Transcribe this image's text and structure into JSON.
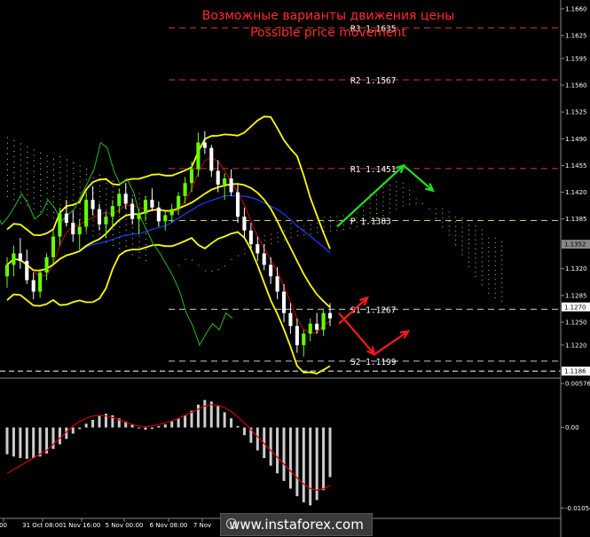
{
  "chart_data": {
    "type": "candlestick",
    "title": "Возможные варианты движения цены",
    "subtitle": "Possible price movement",
    "y_ticks": [
      "1.1660",
      "1.1625",
      "1.1595",
      "1.1560",
      "1.1525",
      "1.1490",
      "1.1455",
      "1.1420",
      "1.1385",
      "1.1320",
      "1.1285",
      "1.1250",
      "1.1220"
    ],
    "x_ticks": [
      "00",
      "31 Oct 08:00",
      "1 Nov 16:00",
      "5 Nov 00:00",
      "6 Nov 08:00",
      "7 Nov"
    ],
    "ylim": [
      1.1178,
      1.1668
    ],
    "current_price": "1.1352",
    "price_marker_1": "1.1270",
    "price_marker_2": "1.1186",
    "levels": [
      {
        "name": "R3",
        "value": 1.1635,
        "label": "R3 1.1635",
        "color": "#d23a3a"
      },
      {
        "name": "R2",
        "value": 1.1567,
        "label": "R2 1.1567",
        "color": "#d23a3a"
      },
      {
        "name": "R1",
        "value": 1.1451,
        "label": "R1 1.1451",
        "color": "#d23a3a"
      },
      {
        "name": "P",
        "value": 1.1383,
        "label": "P 1.1383",
        "color": "#d8c27a"
      },
      {
        "name": "S1",
        "value": 1.1267,
        "label": "S1 1.1267",
        "color": "#cccccc"
      },
      {
        "name": "S2",
        "value": 1.1199,
        "label": "S2 1.1199",
        "color": "#cccccc"
      }
    ],
    "candles": [
      [
        1.131,
        1.1335,
        1.1295,
        1.1325
      ],
      [
        1.1325,
        1.135,
        1.131,
        1.134
      ],
      [
        1.134,
        1.136,
        1.132,
        1.133
      ],
      [
        1.133,
        1.1345,
        1.13,
        1.1305
      ],
      [
        1.1305,
        1.1315,
        1.128,
        1.129
      ],
      [
        1.129,
        1.132,
        1.1282,
        1.1315
      ],
      [
        1.1315,
        1.134,
        1.1305,
        1.1335
      ],
      [
        1.1335,
        1.137,
        1.1325,
        1.1362
      ],
      [
        1.1362,
        1.14,
        1.135,
        1.1392
      ],
      [
        1.1392,
        1.141,
        1.1375,
        1.138
      ],
      [
        1.138,
        1.1395,
        1.1355,
        1.1365
      ],
      [
        1.1365,
        1.1385,
        1.1345,
        1.1375
      ],
      [
        1.1375,
        1.142,
        1.1368,
        1.141
      ],
      [
        1.141,
        1.1428,
        1.139,
        1.1398
      ],
      [
        1.1398,
        1.1405,
        1.137,
        1.1378
      ],
      [
        1.1378,
        1.1395,
        1.136,
        1.1388
      ],
      [
        1.1388,
        1.141,
        1.1375,
        1.1402
      ],
      [
        1.1402,
        1.1425,
        1.1392,
        1.1418
      ],
      [
        1.1418,
        1.1432,
        1.1398,
        1.1405
      ],
      [
        1.1405,
        1.1412,
        1.1378,
        1.1385
      ],
      [
        1.1385,
        1.1398,
        1.1365,
        1.1392
      ],
      [
        1.1392,
        1.1415,
        1.1382,
        1.141
      ],
      [
        1.141,
        1.1425,
        1.1395,
        1.14
      ],
      [
        1.14,
        1.1408,
        1.1375,
        1.1382
      ],
      [
        1.1382,
        1.1395,
        1.137,
        1.139
      ],
      [
        1.139,
        1.1405,
        1.138,
        1.1398
      ],
      [
        1.1398,
        1.142,
        1.139,
        1.1415
      ],
      [
        1.1415,
        1.144,
        1.1405,
        1.1432
      ],
      [
        1.1432,
        1.146,
        1.142,
        1.145
      ],
      [
        1.145,
        1.1498,
        1.144,
        1.1485
      ],
      [
        1.1485,
        1.15,
        1.147,
        1.1478
      ],
      [
        1.1478,
        1.1482,
        1.144,
        1.1448
      ],
      [
        1.1448,
        1.1462,
        1.142,
        1.143
      ],
      [
        1.143,
        1.1445,
        1.141,
        1.1438
      ],
      [
        1.1438,
        1.145,
        1.1415,
        1.142
      ],
      [
        1.142,
        1.143,
        1.138,
        1.1388
      ],
      [
        1.1388,
        1.14,
        1.136,
        1.137
      ],
      [
        1.137,
        1.138,
        1.1345,
        1.1352
      ],
      [
        1.1352,
        1.1362,
        1.133,
        1.134
      ],
      [
        1.134,
        1.1352,
        1.1318,
        1.1325
      ],
      [
        1.1325,
        1.1335,
        1.13,
        1.131
      ],
      [
        1.131,
        1.1322,
        1.128,
        1.129
      ],
      [
        1.129,
        1.13,
        1.125,
        1.1262
      ],
      [
        1.1262,
        1.1275,
        1.1235,
        1.1245
      ],
      [
        1.1245,
        1.1255,
        1.121,
        1.122
      ],
      [
        1.122,
        1.124,
        1.1205,
        1.1235
      ],
      [
        1.1235,
        1.1255,
        1.1225,
        1.1248
      ],
      [
        1.1248,
        1.1262,
        1.1235,
        1.124
      ],
      [
        1.124,
        1.1268,
        1.1232,
        1.1262
      ],
      [
        1.1262,
        1.1275,
        1.1245,
        1.1255
      ]
    ],
    "macd": {
      "y_ticks": [
        "0.00576",
        "0.00",
        "-0.01054"
      ],
      "ylim": [
        -0.0112,
        0.006
      ],
      "histogram": [
        -0.0035,
        -0.0038,
        -0.004,
        -0.0041,
        -0.004,
        -0.0038,
        -0.0034,
        -0.0028,
        -0.0022,
        -0.0015,
        -0.0008,
        -0.0002,
        0.0005,
        0.001,
        0.0015,
        0.0018,
        0.0016,
        0.0012,
        0.0008,
        0.0004,
        0.0,
        -0.0003,
        -0.0002,
        0.0002,
        0.0004,
        0.0008,
        0.0012,
        0.0016,
        0.0022,
        0.003,
        0.0036,
        0.0034,
        0.0028,
        0.002,
        0.0012,
        0.0002,
        -0.001,
        -0.002,
        -0.003,
        -0.004,
        -0.005,
        -0.006,
        -0.007,
        -0.008,
        -0.009,
        -0.0098,
        -0.0102,
        -0.0095,
        -0.0082,
        -0.0065
      ],
      "signal": [
        -0.006,
        -0.0055,
        -0.005,
        -0.0045,
        -0.004,
        -0.0035,
        -0.003,
        -0.0022,
        -0.0014,
        -0.0006,
        0.0002,
        0.0008,
        0.0012,
        0.0015,
        0.0016,
        0.0015,
        0.0013,
        0.001,
        0.0007,
        0.0004,
        0.0002,
        0.0001,
        0.0002,
        0.0004,
        0.0006,
        0.0009,
        0.0012,
        0.0016,
        0.002,
        0.0024,
        0.0028,
        0.003,
        0.0029,
        0.0026,
        0.0021,
        0.0014,
        0.0006,
        -0.0003,
        -0.0012,
        -0.0021,
        -0.003,
        -0.0039,
        -0.0048,
        -0.0057,
        -0.0066,
        -0.0074,
        -0.008,
        -0.0082,
        -0.008,
        -0.0076
      ]
    }
  },
  "watermark": "www.instaforex.com",
  "colors": {
    "background": "#000000",
    "bull": "#66ff00",
    "bear": "#ffffff",
    "bands": "#ffff00",
    "ma_red": "#cc0000",
    "ma_blue": "#1e3cff",
    "macd_signal": "#cc0000",
    "macd_hist": "#cccccc",
    "arrow_green": "#22dd22",
    "arrow_red": "#ff1a1a"
  }
}
